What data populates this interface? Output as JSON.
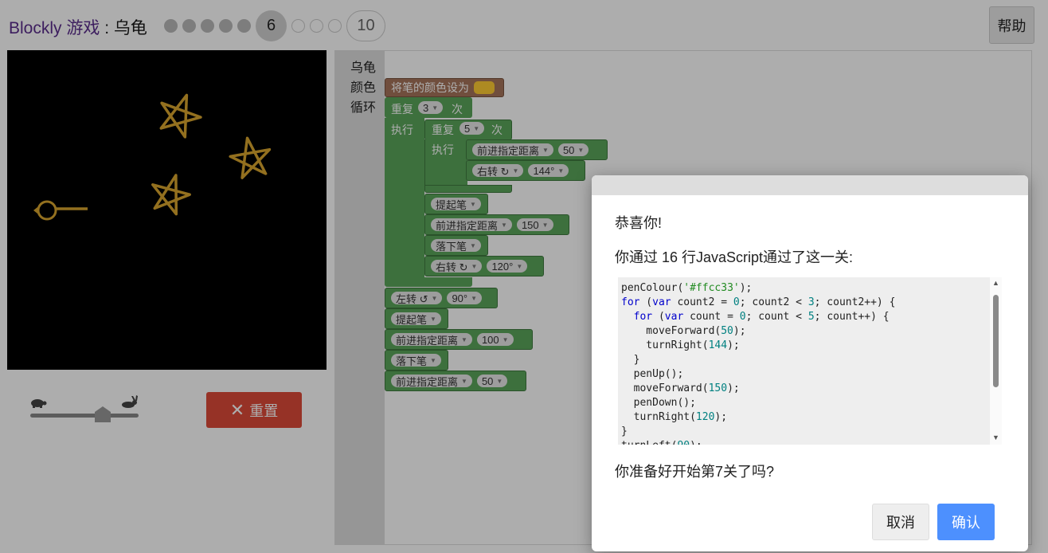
{
  "header": {
    "app_name": "Blockly 游戏",
    "separator": " : ",
    "game_name": "乌龟",
    "current_level": "6",
    "last_level": "10",
    "help_label": "帮助"
  },
  "toolbox": {
    "categories": [
      "乌龟",
      "颜色",
      "循环"
    ]
  },
  "controls": {
    "reset_label": "重置",
    "speed_level": 0.7
  },
  "blocks": {
    "set_colour": "将笔的颜色设为",
    "pen_colour_value": "#ffcc33",
    "repeat_outer": {
      "label": "重复",
      "times": "3",
      "suffix": "次",
      "do": "执行"
    },
    "repeat_inner": {
      "label": "重复",
      "times": "5",
      "suffix": "次",
      "do": "执行"
    },
    "move_forward": "前进指定距离",
    "turn_right": "右转 ↻",
    "turn_left": "左转 ↺",
    "pen_up": "提起笔",
    "pen_down": "落下笔",
    "values": {
      "inner_forward": "50",
      "inner_turn": "144°",
      "forward_150": "150",
      "turn_120": "120°",
      "turn_left_90": "90°",
      "forward_100": "100",
      "forward_50": "50"
    }
  },
  "dialog": {
    "congrats": "恭喜你!",
    "summary": "你通过 16 行JavaScript通过了这一关:",
    "question": "你准备好开始第7关了吗?",
    "cancel_label": "取消",
    "ok_label": "确认",
    "code_lines": [
      "penColour('#ffcc33');",
      "for (var count2 = 0; count2 < 3; count2++) {",
      "  for (var count = 0; count < 5; count++) {",
      "    moveForward(50);",
      "    turnRight(144);",
      "  }",
      "  penUp();",
      "  moveForward(150);",
      "  penDown();",
      "  turnRight(120);",
      "}",
      "turnLeft(90);"
    ]
  },
  "colors": {
    "pen": "#ffcc33",
    "turtle": "#d9a62e",
    "block_green": "#5ba55b",
    "block_brown": "#a5745b",
    "reset_red": "#dd4b39",
    "ok_blue": "#4d90fe"
  }
}
